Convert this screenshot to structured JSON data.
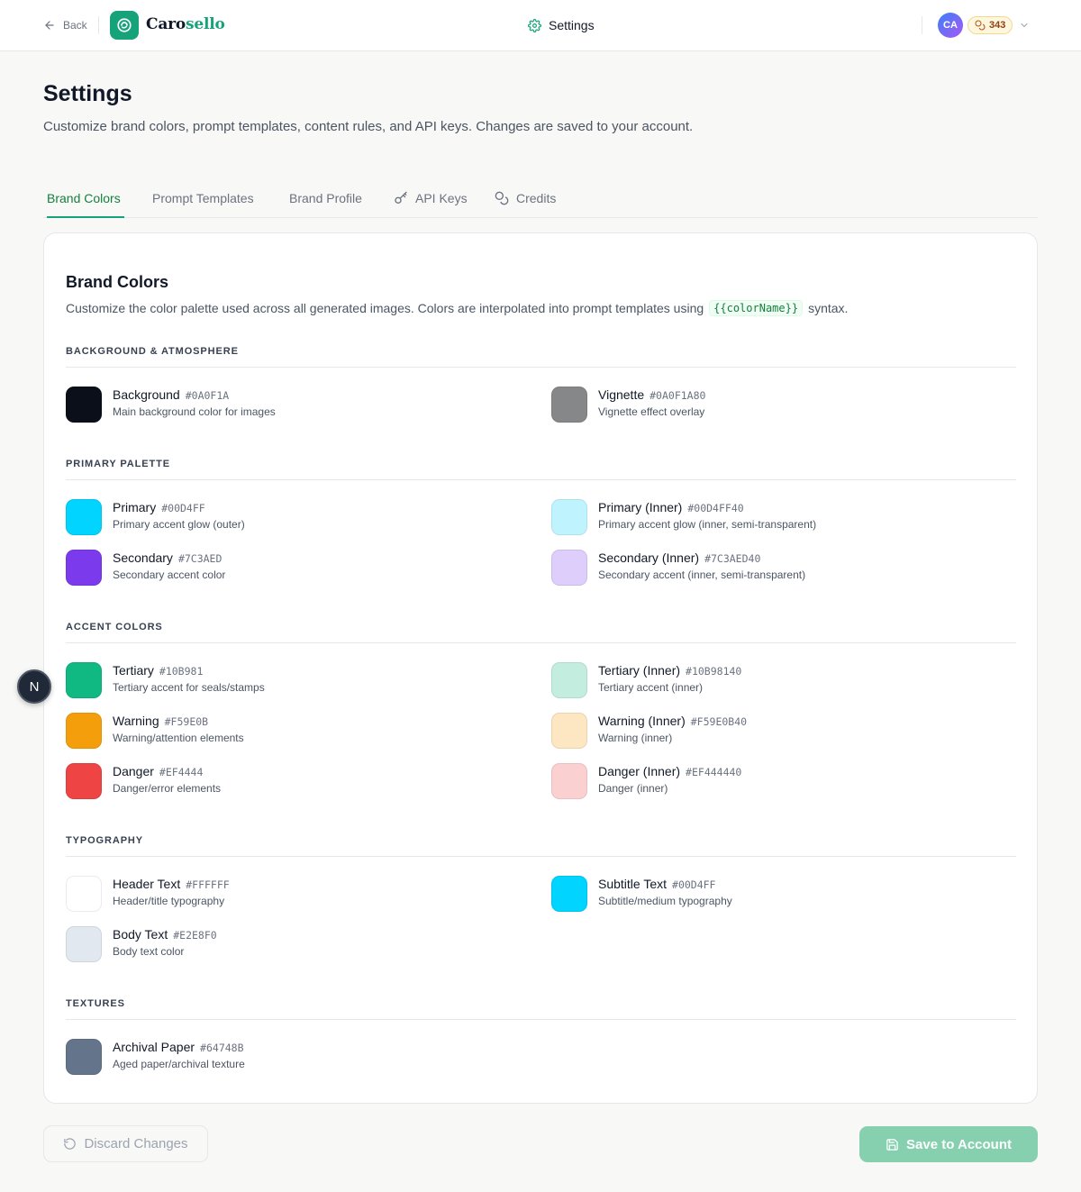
{
  "header": {
    "back_label": "Back",
    "logo_text_a": "Caro",
    "logo_text_b": "sello",
    "center_title": "Settings",
    "avatar_initials": "CA",
    "credits": "343"
  },
  "page": {
    "title": "Settings",
    "description": "Customize brand colors, prompt templates, content rules, and API keys. Changes are saved to your account."
  },
  "tabs": [
    {
      "label": "Brand Colors"
    },
    {
      "label": "Prompt Templates"
    },
    {
      "label": "Brand Profile"
    },
    {
      "label": "API Keys"
    },
    {
      "label": "Credits"
    }
  ],
  "card": {
    "title": "Brand Colors",
    "desc_before": "Customize the color palette used across all generated images. Colors are interpolated into prompt templates using",
    "desc_code": "{{colorName}}",
    "desc_after": "syntax."
  },
  "sections": [
    {
      "label": "BACKGROUND & ATMOSPHERE"
    },
    {
      "label": "PRIMARY PALETTE"
    },
    {
      "label": "ACCENT COLORS"
    },
    {
      "label": "TYPOGRAPHY"
    },
    {
      "label": "TEXTURES"
    }
  ],
  "colors": {
    "background": {
      "name": "Background",
      "hex": "#0A0F1A",
      "desc": "Main background color for images",
      "swatch": "#0a0f1a"
    },
    "vignette": {
      "name": "Vignette",
      "hex": "#0A0F1A80",
      "desc": "Vignette effect overlay",
      "swatch": "#858789"
    },
    "primary": {
      "name": "Primary",
      "hex": "#00D4FF",
      "desc": "Primary accent glow (outer)",
      "swatch": "#00d4ff"
    },
    "primary_inner": {
      "name": "Primary (Inner)",
      "hex": "#00D4FF40",
      "desc": "Primary accent glow (inner, semi-transparent)",
      "swatch": "#bff4ff"
    },
    "secondary": {
      "name": "Secondary",
      "hex": "#7C3AED",
      "desc": "Secondary accent color",
      "swatch": "#7c3aed"
    },
    "secondary_inner": {
      "name": "Secondary (Inner)",
      "hex": "#7C3AED40",
      "desc": "Secondary accent (inner, semi-transparent)",
      "swatch": "#decefb"
    },
    "tertiary": {
      "name": "Tertiary",
      "hex": "#10B981",
      "desc": "Tertiary accent for seals/stamps",
      "swatch": "#10b981"
    },
    "tertiary_inner": {
      "name": "Tertiary (Inner)",
      "hex": "#10B98140",
      "desc": "Tertiary accent (inner)",
      "swatch": "#c3eedf"
    },
    "warning": {
      "name": "Warning",
      "hex": "#F59E0B",
      "desc": "Warning/attention elements",
      "swatch": "#f59e0b"
    },
    "warning_inner": {
      "name": "Warning (Inner)",
      "hex": "#F59E0B40",
      "desc": "Warning (inner)",
      "swatch": "#fde7c2"
    },
    "danger": {
      "name": "Danger",
      "hex": "#EF4444",
      "desc": "Danger/error elements",
      "swatch": "#ef4444"
    },
    "danger_inner": {
      "name": "Danger (Inner)",
      "hex": "#EF444440",
      "desc": "Danger (inner)",
      "swatch": "#fbd0d0"
    },
    "header_text": {
      "name": "Header Text",
      "hex": "#FFFFFF",
      "desc": "Header/title typography",
      "swatch": "#ffffff"
    },
    "subtitle_text": {
      "name": "Subtitle Text",
      "hex": "#00D4FF",
      "desc": "Subtitle/medium typography",
      "swatch": "#00d4ff"
    },
    "body_text": {
      "name": "Body Text",
      "hex": "#E2E8F0",
      "desc": "Body text color",
      "swatch": "#e2e8f0"
    },
    "archival_paper": {
      "name": "Archival Paper",
      "hex": "#64748B",
      "desc": "Aged paper/archival texture",
      "swatch": "#64748b"
    }
  },
  "footer": {
    "discard_label": "Discard Changes",
    "save_label": "Save to Account"
  },
  "floating": {
    "label": "N"
  },
  "theme": {
    "accent": "#16A37A",
    "active_tab": "#15803D"
  },
  "icons": {
    "back": "arrow-left-icon",
    "logo": "carosello-logo-icon",
    "settings": "gear-icon",
    "credits": "coins-icon",
    "chevron": "chevron-down-icon",
    "api_keys": "key-icon",
    "discard": "rotate-ccw-icon",
    "save": "save-icon"
  }
}
